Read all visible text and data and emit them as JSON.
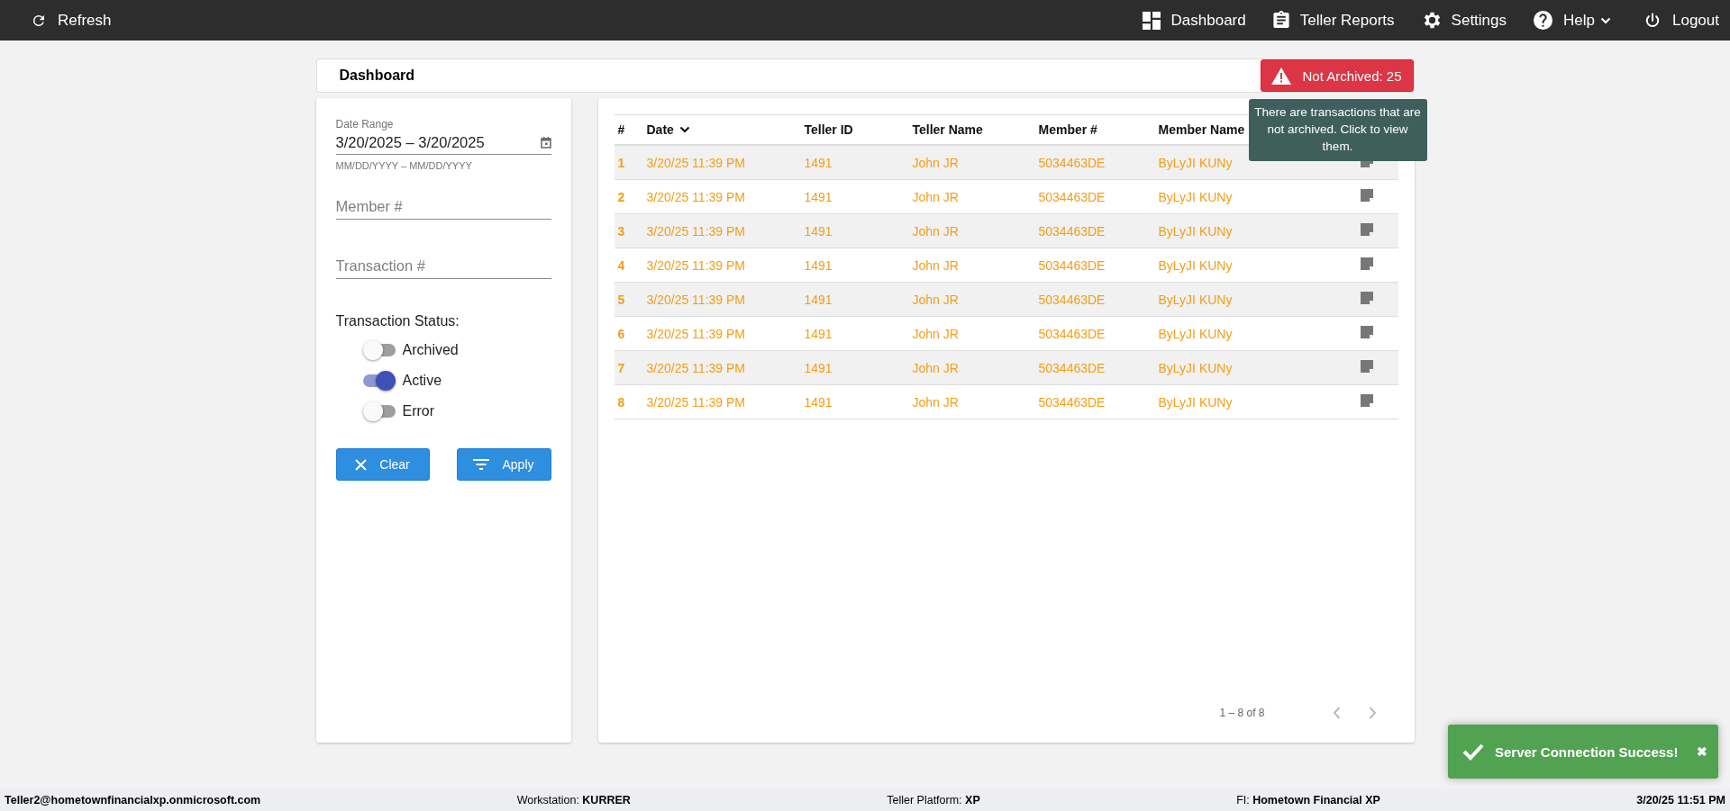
{
  "nav": {
    "refresh": "Refresh",
    "items": [
      {
        "label": "Dashboard",
        "kind": "dashboard",
        "dropdown": false
      },
      {
        "label": "Teller Reports",
        "kind": "reports",
        "dropdown": false
      },
      {
        "label": "Settings",
        "kind": "settings",
        "dropdown": false
      },
      {
        "label": "Help",
        "kind": "help",
        "dropdown": true
      },
      {
        "label": "Logout",
        "kind": "logout",
        "dropdown": false
      }
    ]
  },
  "page_title": "Dashboard",
  "alert": {
    "label": "Not Archived: 25",
    "tooltip": "There are transactions that are not archived. Click to view them."
  },
  "filters": {
    "date_range": {
      "label": "Date Range",
      "value": "3/20/2025 – 3/20/2025",
      "hint": "MM/DD/YYYY – MM/DD/YYYY"
    },
    "fields": [
      {
        "placeholder": "Member #"
      },
      {
        "placeholder": "Transaction #"
      }
    ],
    "status_label": "Transaction Status:",
    "statuses": [
      {
        "label": "Archived",
        "on": false
      },
      {
        "label": "Active",
        "on": true
      },
      {
        "label": "Error",
        "on": false
      }
    ],
    "buttons": [
      {
        "label": "Clear",
        "kind": "clear"
      },
      {
        "label": "Apply",
        "kind": "apply"
      }
    ]
  },
  "table": {
    "columns": [
      {
        "label": "#",
        "sorted": false
      },
      {
        "label": "Date",
        "sorted": true
      },
      {
        "label": "Teller ID",
        "sorted": false
      },
      {
        "label": "Teller Name",
        "sorted": false
      },
      {
        "label": "Member #",
        "sorted": false
      },
      {
        "label": "Member Name",
        "sorted": false
      }
    ],
    "rows": [
      {
        "cells": [
          "1",
          "3/20/25 11:39 PM",
          "1491",
          "John JR",
          "5034463DE",
          "ByLyJI KUNy"
        ]
      },
      {
        "cells": [
          "2",
          "3/20/25 11:39 PM",
          "1491",
          "John JR",
          "5034463DE",
          "ByLyJI KUNy"
        ]
      },
      {
        "cells": [
          "3",
          "3/20/25 11:39 PM",
          "1491",
          "John JR",
          "5034463DE",
          "ByLyJI KUNy"
        ]
      },
      {
        "cells": [
          "4",
          "3/20/25 11:39 PM",
          "1491",
          "John JR",
          "5034463DE",
          "ByLyJI KUNy"
        ]
      },
      {
        "cells": [
          "5",
          "3/20/25 11:39 PM",
          "1491",
          "John JR",
          "5034463DE",
          "ByLyJI KUNy"
        ]
      },
      {
        "cells": [
          "6",
          "3/20/25 11:39 PM",
          "1491",
          "John JR",
          "5034463DE",
          "ByLyJI KUNy"
        ]
      },
      {
        "cells": [
          "7",
          "3/20/25 11:39 PM",
          "1491",
          "John JR",
          "5034463DE",
          "ByLyJI KUNy"
        ]
      },
      {
        "cells": [
          "8",
          "3/20/25 11:39 PM",
          "1491",
          "John JR",
          "5034463DE",
          "ByLyJI KUNy"
        ]
      }
    ]
  },
  "pagination": {
    "range": "1 – 8 of 8"
  },
  "toast": {
    "message": "Server Connection Success!",
    "close": "✖"
  },
  "footer": [
    {
      "kind": "user",
      "value": "Teller2@hometownfinancialxp.onmicrosoft.com"
    },
    {
      "kind": "field",
      "label": "Workstation:",
      "value": "KURRER"
    },
    {
      "kind": "field",
      "label": "Teller Platform:",
      "value": "XP"
    },
    {
      "kind": "field",
      "label": "FI:",
      "value": "Hometown Financial XP"
    },
    {
      "kind": "clock",
      "value": "3/20/25 11:51 PM"
    }
  ]
}
